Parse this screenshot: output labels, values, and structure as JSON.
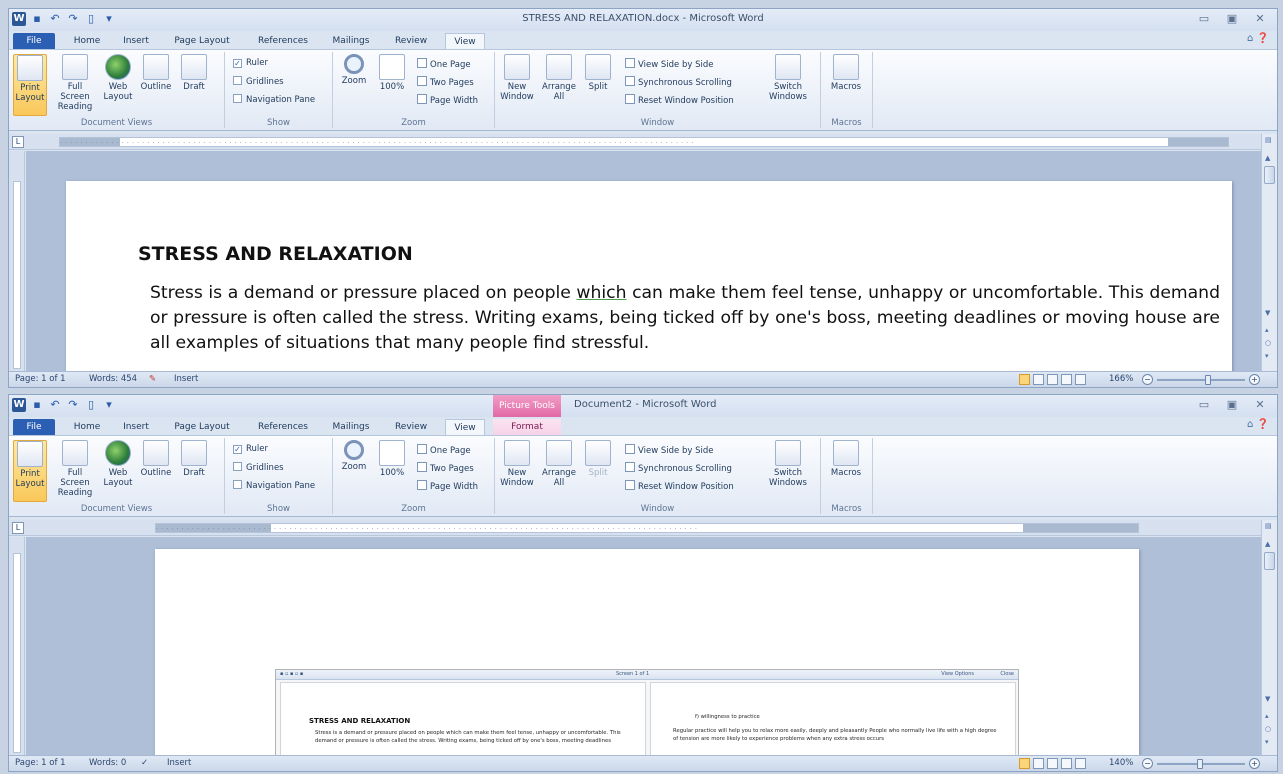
{
  "window1": {
    "title": "STRESS AND RELAXATION.docx - Microsoft Word",
    "tabs": [
      "File",
      "Home",
      "Insert",
      "Page Layout",
      "References",
      "Mailings",
      "Review",
      "View"
    ],
    "active_tab": "View",
    "ribbon": {
      "document_views": {
        "label": "Document Views",
        "buttons": [
          "Print Layout",
          "Full Screen Reading",
          "Web Layout",
          "Outline",
          "Draft"
        ]
      },
      "show": {
        "label": "Show",
        "items": [
          {
            "label": "Ruler",
            "checked": true
          },
          {
            "label": "Gridlines",
            "checked": false
          },
          {
            "label": "Navigation Pane",
            "checked": false
          }
        ]
      },
      "zoom": {
        "label": "Zoom",
        "zoom_label": "Zoom",
        "hundred_label": "100%",
        "one_page": "One Page",
        "two_pages": "Two Pages",
        "page_width": "Page Width"
      },
      "window": {
        "label": "Window",
        "new_window": "New Window",
        "arrange_all": "Arrange All",
        "split": "Split",
        "view_side_by_side": "View Side by Side",
        "sync_scrolling": "Synchronous Scrolling",
        "reset_position": "Reset Window Position",
        "switch_windows": "Switch Windows"
      },
      "macros": {
        "label": "Macros",
        "button": "Macros"
      }
    },
    "document": {
      "heading": "STRESS AND RELAXATION",
      "para_before": "Stress is a demand or pressure placed on people ",
      "para_underlined": "which",
      "para_after": " can make them feel tense, unhappy or uncomfortable. This demand or pressure is often called the stress. Writing exams, being ticked off by one's boss, meeting deadlines or moving house are all examples of situations that many people find stressful."
    },
    "status": {
      "page": "Page: 1 of 1",
      "words": "Words: 454",
      "mode": "Insert",
      "zoom": "166%"
    }
  },
  "window2": {
    "title": "Document2 - Microsoft Word",
    "context_tab": "Picture Tools",
    "tabs": [
      "File",
      "Home",
      "Insert",
      "Page Layout",
      "References",
      "Mailings",
      "Review",
      "View",
      "Format"
    ],
    "active_tab": "View",
    "screenshot": {
      "left_heading": "STRESS AND RELAXATION",
      "left_text": "Stress is a demand or pressure placed on people which can make them feel tense, unhappy or uncomfortable. This demand or pressure is often called the stress. Writing exams, being ticked off by one's boss, meeting deadlines",
      "right_item": "f)  willingness to practice",
      "right_text": "Regular practice will help you to relax more easily, deeply and pleasantly People who normally live life with a high degree of tension are more likely to experience problems when any extra stress occurs",
      "screen_label": "Screen 1 of 1",
      "view_options": "View Options",
      "close": "Close"
    },
    "status": {
      "page": "Page: 1 of 1",
      "words": "Words: 0",
      "mode": "Insert",
      "zoom": "140%"
    }
  },
  "accent": {
    "file_tab": "#2b5fb3",
    "picture_tools": "#e26aa5",
    "title_text": "#3b4f6b"
  }
}
